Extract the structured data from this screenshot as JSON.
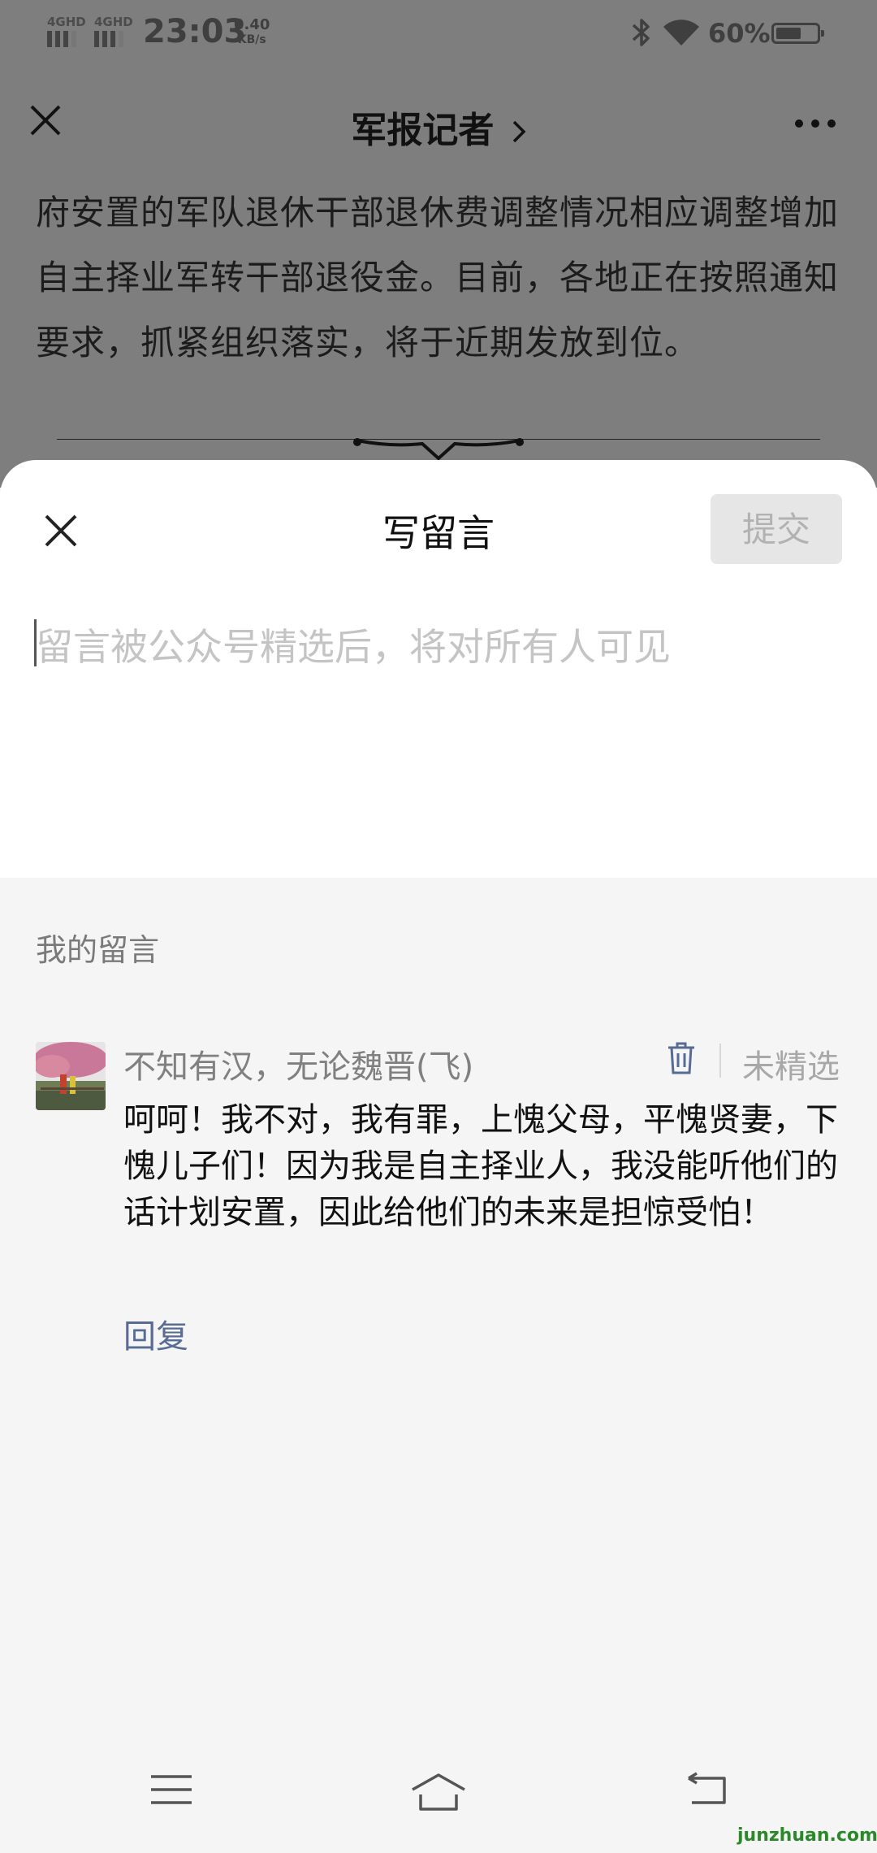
{
  "status_bar": {
    "signal1": "4GHD",
    "signal2": "4GHD",
    "time": "23:03",
    "speed_value": "0.40",
    "speed_unit": "KB/s",
    "battery_percent": "60%"
  },
  "header": {
    "title": "军报记者"
  },
  "article": {
    "text": "府安置的军队退休干部退休费调整情况相应调整增加自主择业军转干部退役金。目前，各地正在按照通知要求，抓紧组织落实，将于近期发放到位。"
  },
  "compose": {
    "title": "写留言",
    "submit_label": "提交",
    "placeholder": "留言被公众号精选后，将对所有人可见",
    "value": ""
  },
  "my_comments": {
    "section_title": "我的留言",
    "items": [
      {
        "nickname": "不知有汉，无论魏晋(飞)",
        "status": "未精选",
        "text": "呵呵！我不对，我有罪，上愧父母，平愧贤妻，下愧儿子们！因为我是自主择业人，我没能听他们的话计划安置，因此给他们的未来是担惊受怕！",
        "reply_label": "回复"
      }
    ]
  },
  "watermark": "junzhuan.com",
  "colors": {
    "link": "#576b95",
    "overlay": "#7e7e7e",
    "sheet": "#ffffff",
    "background": "#f5f5f5"
  },
  "icons": [
    "close-icon",
    "chevron-right-icon",
    "more-icon",
    "trash-icon",
    "bluetooth-icon",
    "wifi-icon",
    "battery-icon",
    "menu-icon",
    "home-icon",
    "back-icon"
  ]
}
